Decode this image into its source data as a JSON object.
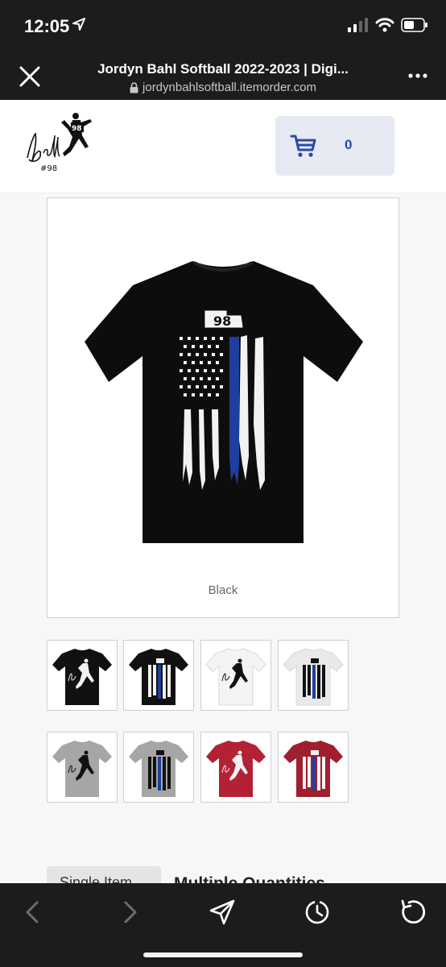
{
  "status": {
    "time": "12:05"
  },
  "browser": {
    "title": "Jordyn Bahl Softball 2022-2023 | Digi...",
    "url": "jordynbahlsoftball.itemorder.com"
  },
  "header": {
    "logo_text": "Bahl #98",
    "cart_count": "0"
  },
  "product": {
    "main_caption": "Black",
    "jersey_number": "98",
    "thumbnails": [
      {
        "shirt_color": "#111111",
        "design": "pitcher"
      },
      {
        "shirt_color": "#111111",
        "design": "flag"
      },
      {
        "shirt_color": "#f4f4f4",
        "design": "pitcher"
      },
      {
        "shirt_color": "#e9e9e9",
        "design": "flag"
      },
      {
        "shirt_color": "#a6a6a6",
        "design": "pitcher"
      },
      {
        "shirt_color": "#a6a6a6",
        "design": "flag"
      },
      {
        "shirt_color": "#b22234",
        "design": "pitcher"
      },
      {
        "shirt_color": "#9e1f2e",
        "design": "flag"
      }
    ]
  },
  "tabs": {
    "single": "Single Item",
    "multiple": "Multiple Quantities"
  },
  "colors": {
    "accent_blue": "#2b4aa8",
    "thin_blue_line": "#1e3fa0"
  },
  "toolbar_icons": [
    "back-icon",
    "forward-icon",
    "share-icon",
    "history-icon",
    "reload-icon"
  ]
}
